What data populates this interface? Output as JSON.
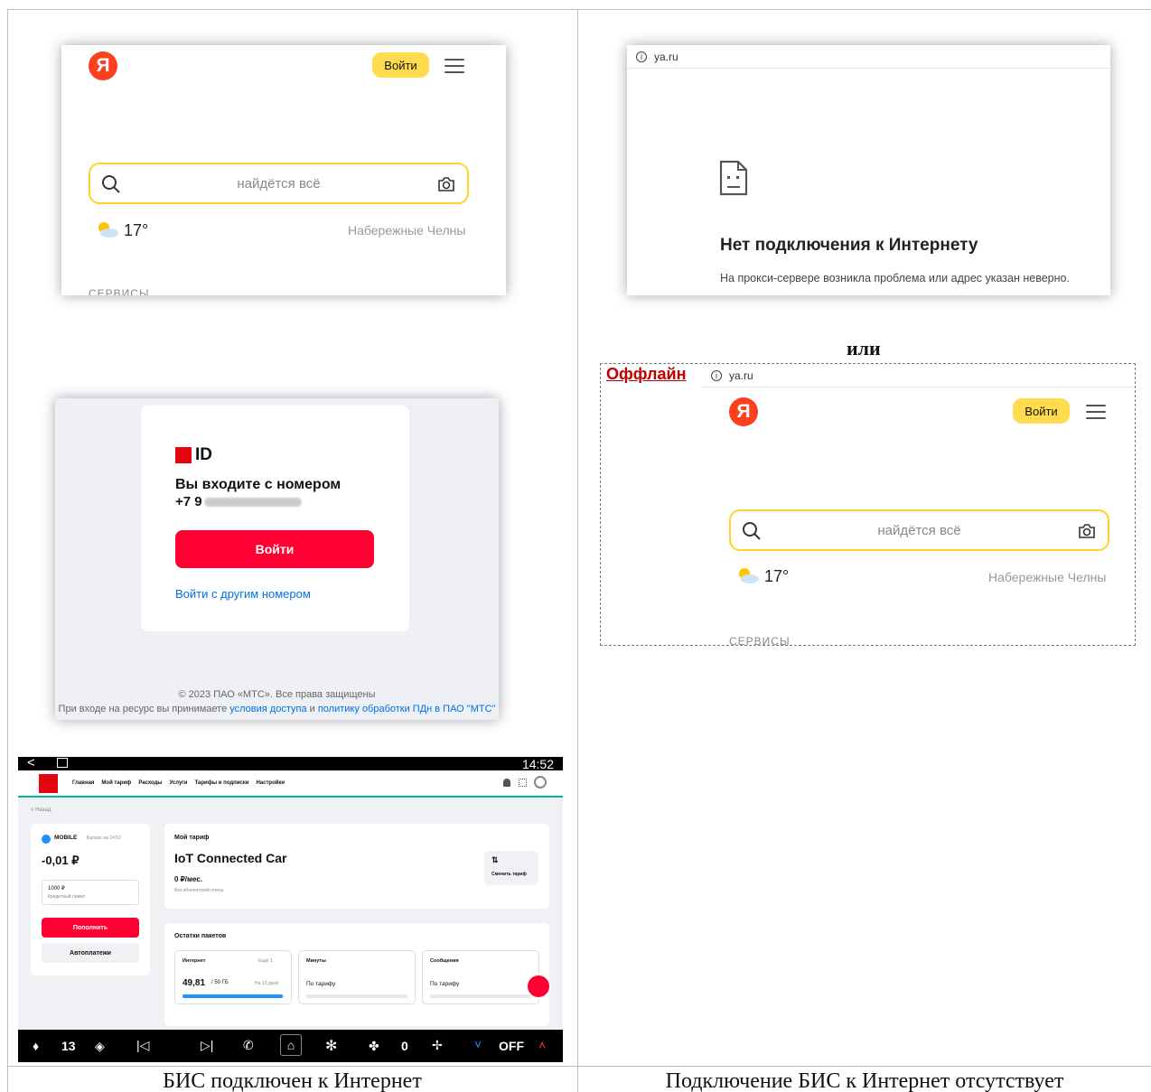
{
  "captions": {
    "left": "БИС подключен к Интернет",
    "right": "Подключение БИС к Интернет отсутствует"
  },
  "yandex": {
    "logo": "Я",
    "login_label": "Войти",
    "search_placeholder": "найдётся всё",
    "temperature": "17°",
    "city": "Набережные Челны",
    "services_label": "СЕРВИСЫ",
    "url": "ya.ru"
  },
  "offline_page": {
    "url": "ya.ru",
    "title": "Нет подключения к Интернету",
    "subtitle": "На прокси-сервере возникла проблема или адрес указан неверно."
  },
  "or_label": "или",
  "offline_badge": "Оффлайн",
  "mts_id": {
    "logo_text": "ID",
    "line1": "Вы входите с номером",
    "phone_prefix": "+7 9",
    "login_button": "Войти",
    "other_number_link": "Войти с другим номером",
    "footer_line1": "© 2023 ПАО «МТС». Все права защищены",
    "footer_line2_a": "При входе на ресурс вы принимаете ",
    "footer_link1": "условия доступа",
    "footer_line2_b": " и ",
    "footer_link2": "политику обработки ПДн в ПАО \"МТС\""
  },
  "car_screen": {
    "time": "14:52",
    "nav": [
      "Главная",
      "Мой тариф",
      "Расходы",
      "Услуги",
      "Тарифы и подписки",
      "Настройки"
    ],
    "back": "< Назад",
    "account_label": "MOBILE",
    "balance_caption": "Баланс на 14:52",
    "balance": "-0,01 ₽",
    "credit_value": "1000 ₽",
    "credit_label": "Кредитный лимит",
    "topup_button": "Пополнить",
    "autopay_button": "Автоплатежи",
    "my_tariff_label": "Мой тариф",
    "tariff_name": "IoT Connected Car",
    "tariff_price": "0 ₽/мес.",
    "tariff_note": "Без абонентской платы",
    "change_tariff": "Сменить тариф",
    "packages_title": "Остатки пакетов",
    "internet_label": "Интернет",
    "internet_more": "Ещё 1",
    "internet_value": "49,81",
    "internet_total": "/ 50 ГБ",
    "internet_days": "На 13 дней",
    "minutes_label": "Минуты",
    "minutes_value": "По тарифу",
    "sms_label": "Сообщения",
    "sms_value": "По тарифу",
    "internet_progress": 0.99,
    "volume": "13",
    "fan": "0",
    "ac": "OFF"
  }
}
